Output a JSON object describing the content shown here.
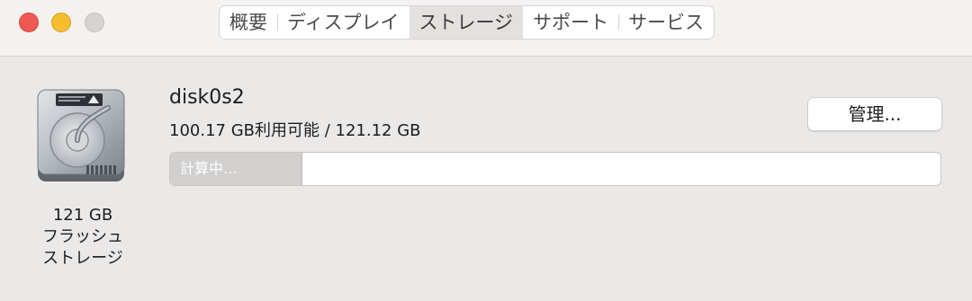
{
  "window": {
    "traffic_lights": {
      "close": "#ee5a52",
      "minimize": "#f5bd2f",
      "zoom": "#d6d3d1"
    }
  },
  "tabs": [
    {
      "label": "概要",
      "active": false
    },
    {
      "label": "ディスプレイ",
      "active": false
    },
    {
      "label": "ストレージ",
      "active": true
    },
    {
      "label": "サポート",
      "active": false
    },
    {
      "label": "サービス",
      "active": false
    }
  ],
  "disk": {
    "icon": "hard-drive-icon",
    "size_label": "121 GB",
    "type_line1": "フラッシュ",
    "type_line2": "ストレージ",
    "name": "disk0s2",
    "capacity_text": "100.17 GB利用可能 / 121.12 GB",
    "usage": {
      "label": "計算中...",
      "fraction": 0.171,
      "segment_color": "#d2d0cf"
    }
  },
  "actions": {
    "manage_label": "管理..."
  }
}
